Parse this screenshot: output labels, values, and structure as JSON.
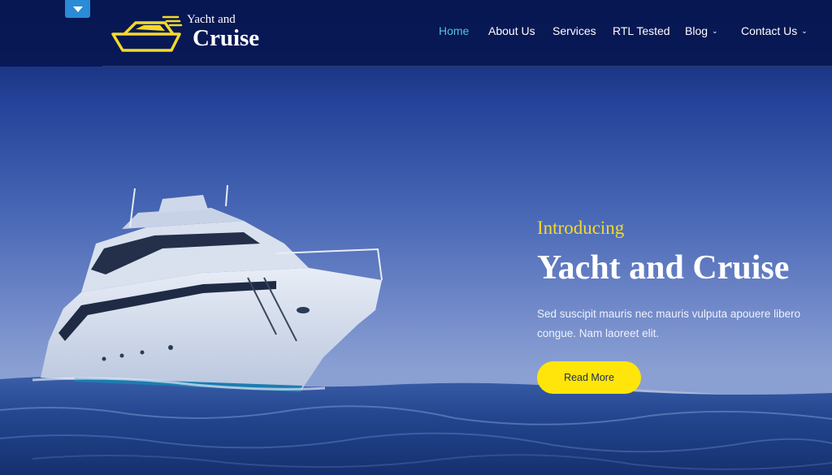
{
  "logo": {
    "small": "Yacht and",
    "big": "Cruise"
  },
  "nav": {
    "home": "Home",
    "about": "About Us",
    "services": "Services",
    "rtl": "RTL Tested",
    "blog": "Blog",
    "contact": "Contact Us"
  },
  "hero": {
    "eyebrow": "Introducing",
    "title": "Yacht and Cruise",
    "description": "Sed suscipit mauris nec mauris vulputa apouere libero congue. Nam laoreet elit.",
    "button": "Read More"
  },
  "colors": {
    "accent": "#ffe50a",
    "active_nav": "#55c1e0",
    "header": "#061650"
  }
}
